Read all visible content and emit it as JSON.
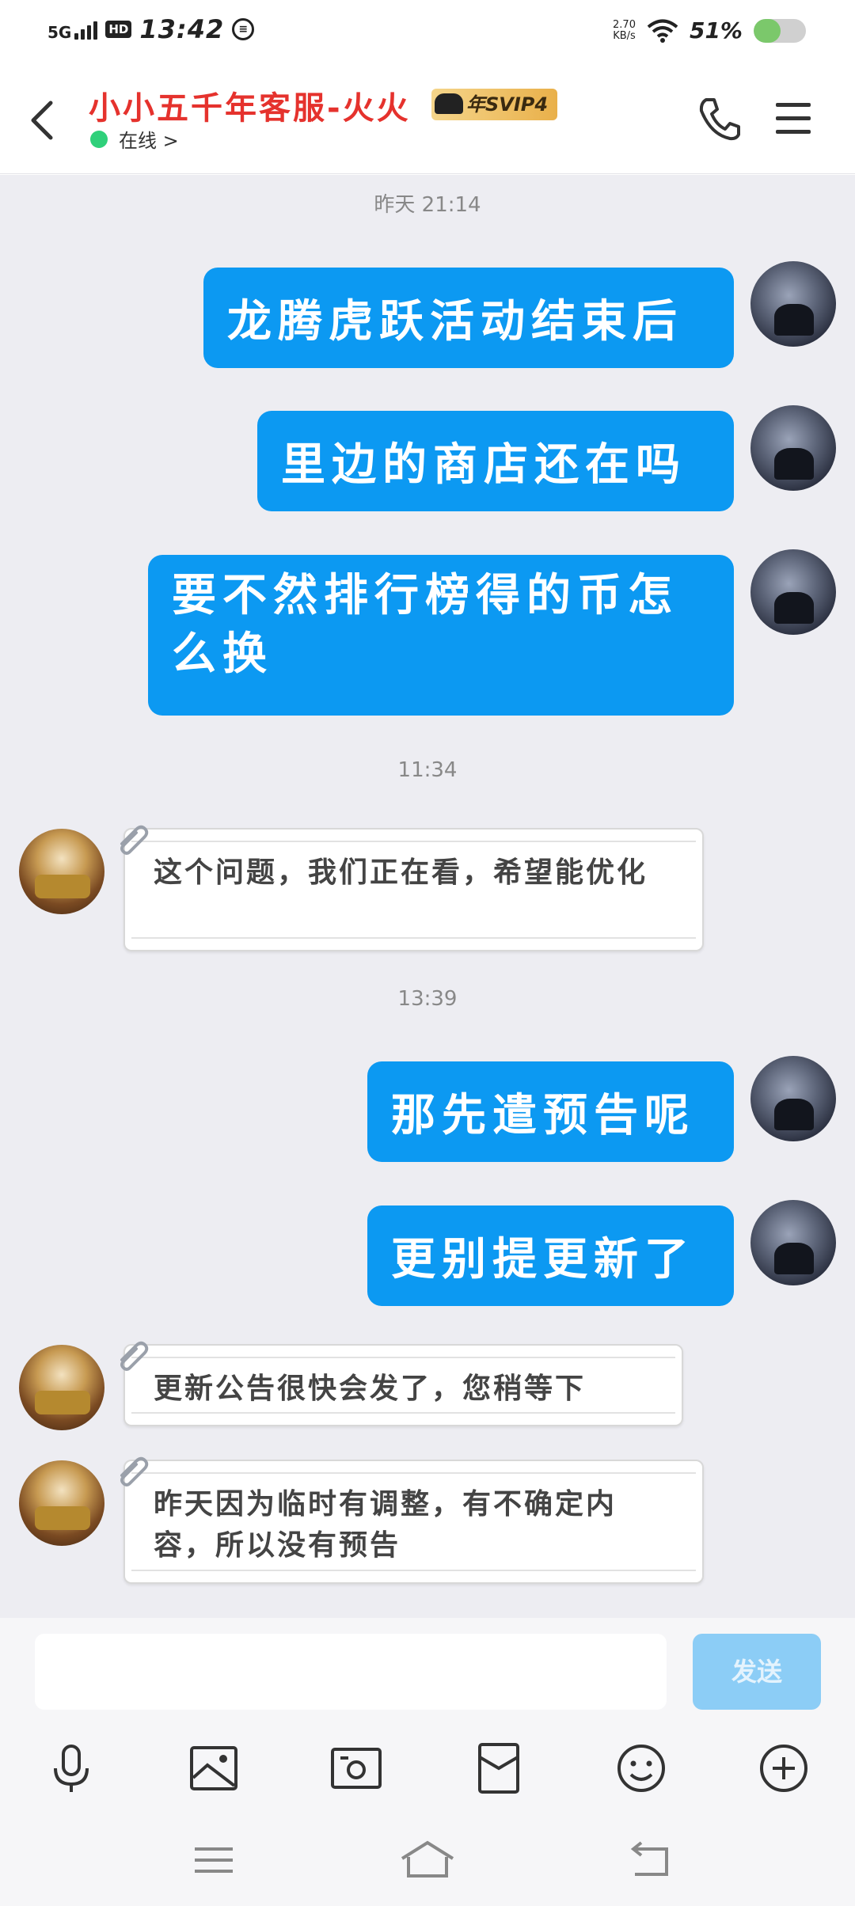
{
  "status_bar": {
    "network": "5G",
    "hd": "HD",
    "time": "13:42",
    "speed_value": "2.70",
    "speed_unit": "KB/s",
    "battery_pct": "51%",
    "battery_level": 0.51
  },
  "header": {
    "title": "小小五千年客服-火火",
    "vip_badge": "年SVIP4",
    "status": "在线 >"
  },
  "chat": {
    "timestamps": [
      "昨天 21:14",
      "11:34",
      "13:39"
    ],
    "my_messages": [
      "龙腾虎跃活动结束后",
      "里边的商店还在吗",
      "要不然排行榜得的币怎么换",
      "那先遣预告呢",
      "更别提更新了"
    ],
    "cs_messages": [
      "这个问题，我们正在看，希望能优化",
      "更新公告很快会发了，您稍等下",
      "昨天因为临时有调整，有不确定内容，所以没有预告"
    ]
  },
  "input": {
    "send_label": "发送"
  },
  "colors": {
    "accent": "#0c99f2",
    "title_red": "#e5322d",
    "online_green": "#2fd07a",
    "chat_bg": "#ededf2"
  }
}
